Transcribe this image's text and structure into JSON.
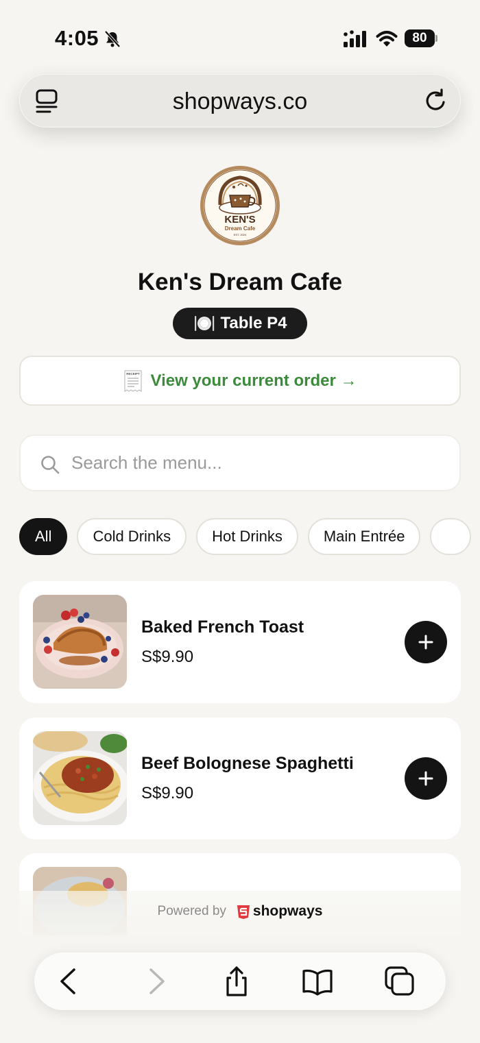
{
  "status_bar": {
    "time": "4:05",
    "battery": "80"
  },
  "browser": {
    "url": "shopways.co"
  },
  "cafe": {
    "name": "Ken's Dream Cafe",
    "table": "Table P4",
    "logo_title": "KEN'S",
    "logo_subtitle": "Dream Cafe",
    "logo_est": "EST. 2024"
  },
  "order": {
    "label": "View your current order →",
    "receipt_icon_text": "RECEIPT"
  },
  "search": {
    "placeholder": "Search the menu..."
  },
  "categories": [
    "All",
    "Cold Drinks",
    "Hot Drinks",
    "Main Entrée",
    ""
  ],
  "menu": [
    {
      "name": "Baked French Toast",
      "price": "S$9.90"
    },
    {
      "name": "Beef Bolognese Spaghetti",
      "price": "S$9.90"
    }
  ],
  "footer": {
    "powered_by": "Powered by",
    "brand": "shopways"
  },
  "colors": {
    "accent_green": "#3c8a3c",
    "dark": "#141414",
    "background": "#f6f5f1",
    "brand_red": "#e0393e"
  },
  "icons": {
    "toolbar": [
      "back-icon",
      "forward-icon",
      "share-icon",
      "bookmarks-icon",
      "tabs-icon"
    ]
  }
}
